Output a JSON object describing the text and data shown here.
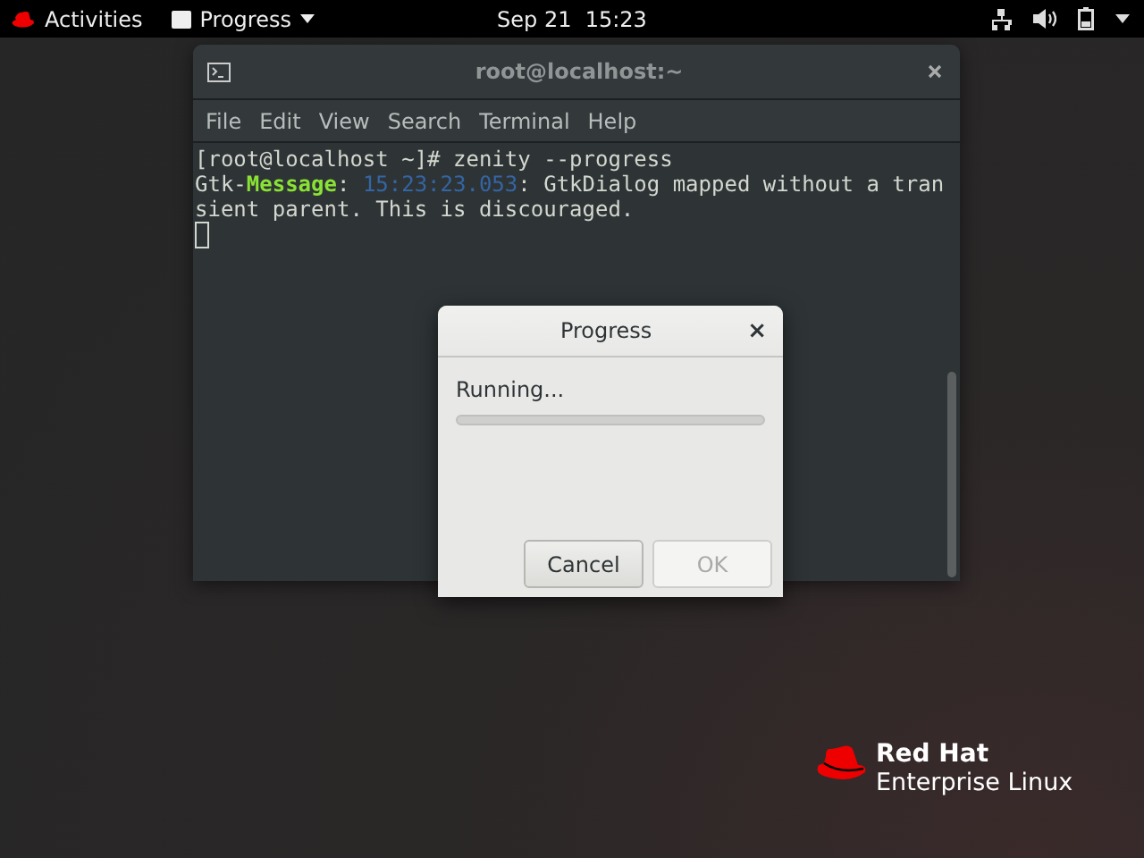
{
  "top_bar": {
    "activities": "Activities",
    "app_menu": "Progress",
    "clock": "Sep 21  15:23"
  },
  "terminal": {
    "title": "root@localhost:~",
    "menu": [
      "File",
      "Edit",
      "View",
      "Search",
      "Terminal",
      "Help"
    ],
    "lines": [
      [
        {
          "kind": "plain",
          "text": "[root@localhost ~]# zenity --progress"
        }
      ],
      [
        {
          "kind": "plain",
          "text": "Gtk-"
        },
        {
          "kind": "keyword",
          "text": "Message"
        },
        {
          "kind": "plain",
          "text": ": "
        },
        {
          "kind": "time",
          "text": "15:23:23.053"
        },
        {
          "kind": "plain",
          "text": ": GtkDialog mapped without a tran"
        }
      ],
      [
        {
          "kind": "plain",
          "text": "sient parent. This is discouraged."
        }
      ]
    ]
  },
  "dialog": {
    "title": "Progress",
    "close": "×",
    "label": "Running...",
    "progress": {
      "level": 0
    },
    "buttons": [
      {
        "label": "Cancel",
        "disabled": false
      },
      {
        "label": "OK",
        "disabled": true
      }
    ]
  },
  "logo": {
    "line1": "Red Hat",
    "line2": "Enterprise Linux"
  }
}
